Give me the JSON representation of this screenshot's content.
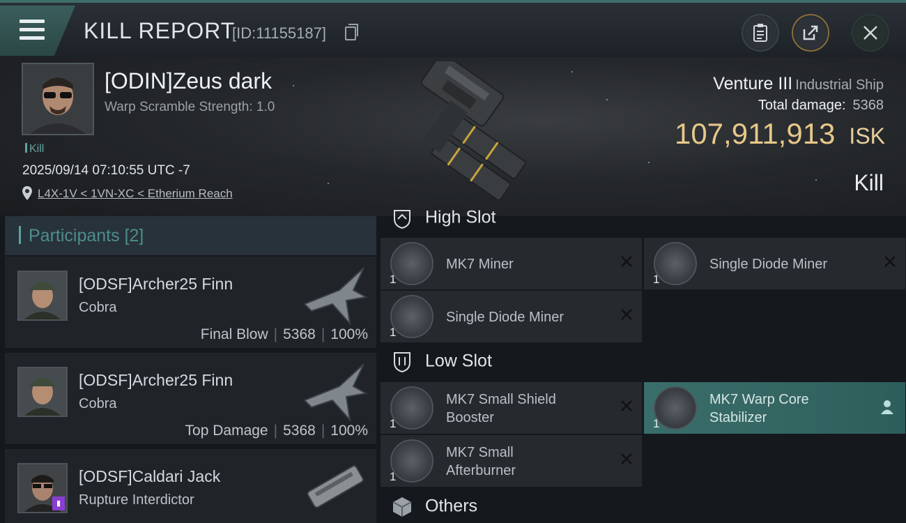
{
  "header": {
    "title": "KILL REPORT",
    "report_id": "[ID:11155187]"
  },
  "victim": {
    "name": "[ODIN]Zeus dark",
    "warp_scramble": "Warp Scramble Strength: 1.0",
    "tag": "Kill",
    "timestamp": "2025/09/14 07:10:55 UTC -7",
    "location": "L4X-1V < 1VN-XC < Etherium Reach"
  },
  "summary": {
    "ship_name": "Venture III",
    "ship_class": "Industrial Ship",
    "total_damage_label": "Total damage:",
    "total_damage": "5368",
    "isk_value": "107,911,913",
    "isk_unit": "ISK",
    "result": "Kill"
  },
  "participants": {
    "title": "Participants",
    "count": "[2]",
    "rows": [
      {
        "name": "[ODSF]Archer25 Finn",
        "ship": "Cobra",
        "role": "Final Blow",
        "damage": "5368",
        "percent": "100%"
      },
      {
        "name": "[ODSF]Archer25 Finn",
        "ship": "Cobra",
        "role": "Top Damage",
        "damage": "5368",
        "percent": "100%"
      },
      {
        "name": "[ODSF]Caldari Jack",
        "ship": "Rupture Interdictor"
      }
    ]
  },
  "fittings": {
    "high_slot_label": "High Slot",
    "low_slot_label": "Low Slot",
    "others_label": "Others",
    "high": [
      {
        "name": "MK7 Miner",
        "qty": "1"
      },
      {
        "name": "Single Diode Miner",
        "qty": "1"
      },
      {
        "name": "Single Diode Miner",
        "qty": "1"
      }
    ],
    "low": [
      {
        "name_line1": "MK7 Small Shield",
        "name_line2": "Booster",
        "qty": "1"
      },
      {
        "name_line1": "MK7 Warp Core",
        "name_line2": "Stabilizer",
        "qty": "1"
      },
      {
        "name_line1": "MK7 Small",
        "name_line2": "Afterburner",
        "qty": "1"
      }
    ]
  },
  "colors": {
    "accent": "#5aa3a0",
    "isk": "#e7c88a",
    "active_slot": "#3a6e6a"
  }
}
